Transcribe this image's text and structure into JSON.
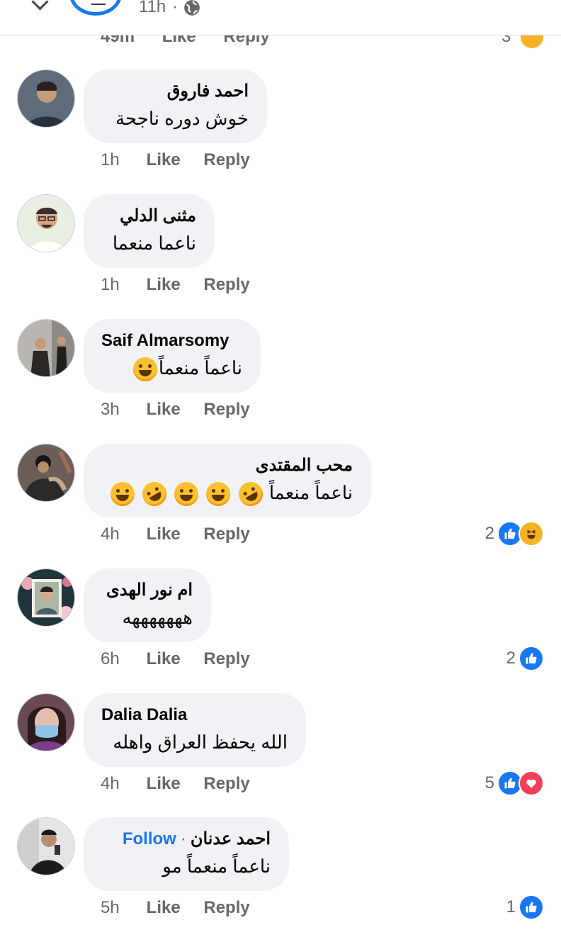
{
  "header": {
    "time": "11h",
    "separator": "·"
  },
  "previous_comment": {
    "time": "49m",
    "like": "Like",
    "reply": "Reply",
    "reaction_count": "3"
  },
  "comments": [
    {
      "name": "احمد فاروق",
      "text": "خوش دوره ناجحة",
      "time": "1h",
      "like": "Like",
      "reply": "Reply"
    },
    {
      "name": "مثنى الدلي",
      "text": "ناعما منعما",
      "time": "1h",
      "like": "Like",
      "reply": "Reply"
    },
    {
      "name": "Saif Almarsomy",
      "text": "ناعماً منعماً",
      "time": "3h",
      "like": "Like",
      "reply": "Reply"
    },
    {
      "name": "محب المقتدى",
      "text": "ناعماً منعماً",
      "time": "4h",
      "like": "Like",
      "reply": "Reply",
      "reaction_count": "2"
    },
    {
      "name": "ام نور الهدى",
      "text": "هههههههه",
      "time": "6h",
      "like": "Like",
      "reply": "Reply",
      "reaction_count": "2"
    },
    {
      "name": "Dalia Dalia",
      "text": "الله يحفظ العراق واهله",
      "time": "4h",
      "like": "Like",
      "reply": "Reply",
      "reaction_count": "5"
    },
    {
      "name": "احمد عدنان",
      "follow": "Follow",
      "follow_sep": "·",
      "text": "ناعماً منعماً مو",
      "time": "5h",
      "like": "Like",
      "reply": "Reply",
      "reaction_count": "1"
    }
  ],
  "colors": {
    "accent": "#1877f2",
    "bubble": "#f0f2f5",
    "meta": "#65676b",
    "love": "#f33e58",
    "haha": "#f7b125"
  }
}
